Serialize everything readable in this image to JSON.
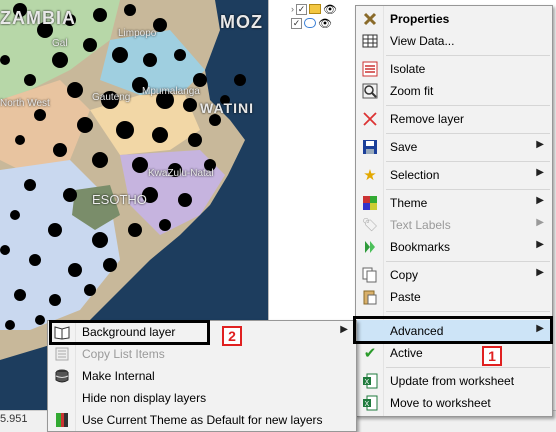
{
  "map": {
    "labels": {
      "country_left": "ZAMBIA",
      "country_right": "MOZ",
      "gal": "Gal",
      "limpopo": "Limpopo",
      "north_west": "North West",
      "gauteng": "Gauteng",
      "mpumalanga": "Mpumalanga",
      "eswatini": "WATINI",
      "kwazulu": "KwaZulu-Natal",
      "lesotho": "ESOTHO"
    }
  },
  "status": {
    "coord": "5.951"
  },
  "tree": {
    "rows": [
      {
        "check": "✓"
      },
      {
        "check": "✓"
      }
    ]
  },
  "context_menu": {
    "items": [
      {
        "label": "Properties",
        "icon": "properties-icon"
      },
      {
        "label": "View Data...",
        "icon": "table-icon"
      },
      {
        "label": "Isolate",
        "icon": "isolate-icon"
      },
      {
        "label": "Zoom fit",
        "icon": "zoom-fit-icon"
      },
      {
        "label": "Remove layer",
        "icon": "remove-icon"
      },
      {
        "label": "Save",
        "icon": "save-icon"
      },
      {
        "label": "Selection",
        "icon": "star-icon"
      },
      {
        "label": "Theme",
        "icon": "theme-icon"
      },
      {
        "label": "Text Labels",
        "icon": "tag-icon"
      },
      {
        "label": "Bookmarks",
        "icon": "bookmark-icon"
      },
      {
        "label": "Copy",
        "icon": "copy-icon"
      },
      {
        "label": "Paste",
        "icon": "paste-icon"
      },
      {
        "label": "Advanced",
        "icon": ""
      },
      {
        "label": "Active",
        "icon": "checkmark-icon"
      },
      {
        "label": "Update from worksheet",
        "icon": "excel-import-icon"
      },
      {
        "label": "Move to worksheet",
        "icon": "excel-export-icon"
      }
    ]
  },
  "submenu": {
    "items": [
      {
        "label": "Background layer",
        "icon": "book-icon"
      },
      {
        "label": "Copy List Items",
        "icon": "list-icon"
      },
      {
        "label": "Make Internal",
        "icon": "database-icon"
      },
      {
        "label": "Hide non display layers",
        "icon": ""
      },
      {
        "label": "Use Current Theme as Default for new layers",
        "icon": "theme-default-icon"
      }
    ]
  },
  "annotations": {
    "badge1": "1",
    "badge2": "2"
  },
  "colors": {
    "highlight": "#cde4f7",
    "badge": "#e02020",
    "submenu_arrow": "#222222"
  }
}
